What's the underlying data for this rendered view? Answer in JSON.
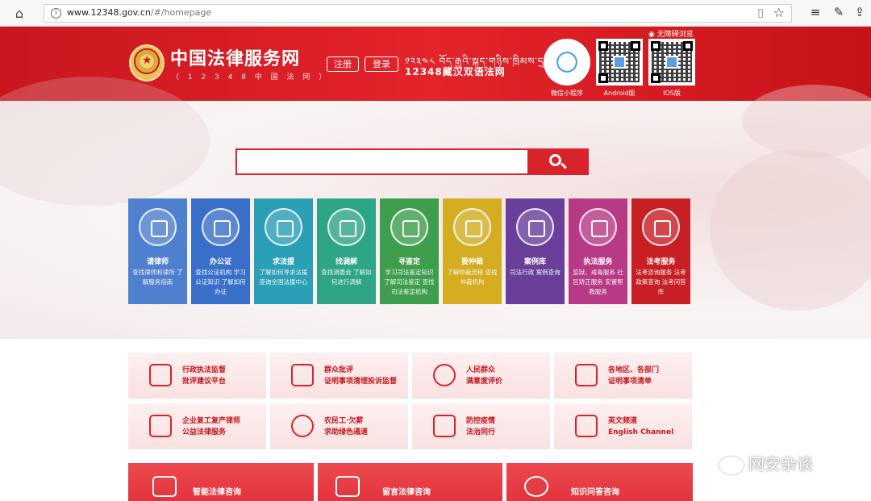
{
  "browser": {
    "url_host": "www.12348.gov.cn",
    "url_path": "/#/homepage"
  },
  "header": {
    "site_title": "中国法律服务网",
    "site_subtitle": "（ 1 2 3 4 8 中 国 法 网 ）",
    "register_label": "注册",
    "login_label": "登录",
    "tibetan_line": "༡༢༣༤༨ བོད་རྒྱའི་སྐད་གཉིས་ཁྲིམས་དྲ",
    "tibetan_sub": "12348藏汉双语法网",
    "accessibility_label": "◉ 无障碍浏览",
    "qr_labels": [
      "微信小程序",
      "Android版",
      "IOS版"
    ]
  },
  "search": {
    "placeholder": ""
  },
  "tiles": [
    {
      "name": "请律师",
      "desc": "查找律师和律所 了解服务指南",
      "color": "#4f7fcf"
    },
    {
      "name": "办公证",
      "desc": "查找公证机构 学习公证知识 了解如何办证",
      "color": "#3a6fc9"
    },
    {
      "name": "求法援",
      "desc": "了解如何寻求法援 查询全国法援中心",
      "color": "#2a9fb6"
    },
    {
      "name": "找调解",
      "desc": "查找调委会 了解如何进行调解",
      "color": "#2fa587"
    },
    {
      "name": "寻鉴定",
      "desc": "学习司法鉴定知识 了解司法鉴定 查找司法鉴定机构",
      "color": "#3e9e4e"
    },
    {
      "name": "要仲裁",
      "desc": "了解仲裁流程 查找仲裁机构",
      "color": "#d4ad20"
    },
    {
      "name": "案例库",
      "desc": "司法行政 案例查询",
      "color": "#6a3f9a"
    },
    {
      "name": "执法服务",
      "desc": "监狱、戒毒服务 社区矫正服务 安置帮教服务",
      "color": "#b83a86"
    },
    {
      "name": "法考服务",
      "desc": "法考咨询服务 法考政策查询 法考问答库",
      "color": "#c81f25"
    }
  ],
  "cards": [
    {
      "line1": "行政执法监督",
      "line2": "批评建议平台"
    },
    {
      "line1": "群众批评",
      "line2": "证明事项清理投诉监督"
    },
    {
      "line1": "人民群众",
      "line2": "满意度评价"
    },
    {
      "line1": "各地区、各部门",
      "line2": "证明事项清单"
    },
    {
      "line1": "企业复工复产律师",
      "line2": "公益法律服务"
    },
    {
      "line1": "农民工·欠薪",
      "line2": "求助绿色通道"
    },
    {
      "line1": "防控疫情",
      "line2": "法治同行"
    },
    {
      "line1": "英文频道",
      "line2": "English Channel"
    }
  ],
  "big_buttons": [
    {
      "label": "智能法律咨询"
    },
    {
      "label": "留言法律咨询"
    },
    {
      "label": "知识问答咨询"
    }
  ],
  "watermark": "网安杂谈"
}
